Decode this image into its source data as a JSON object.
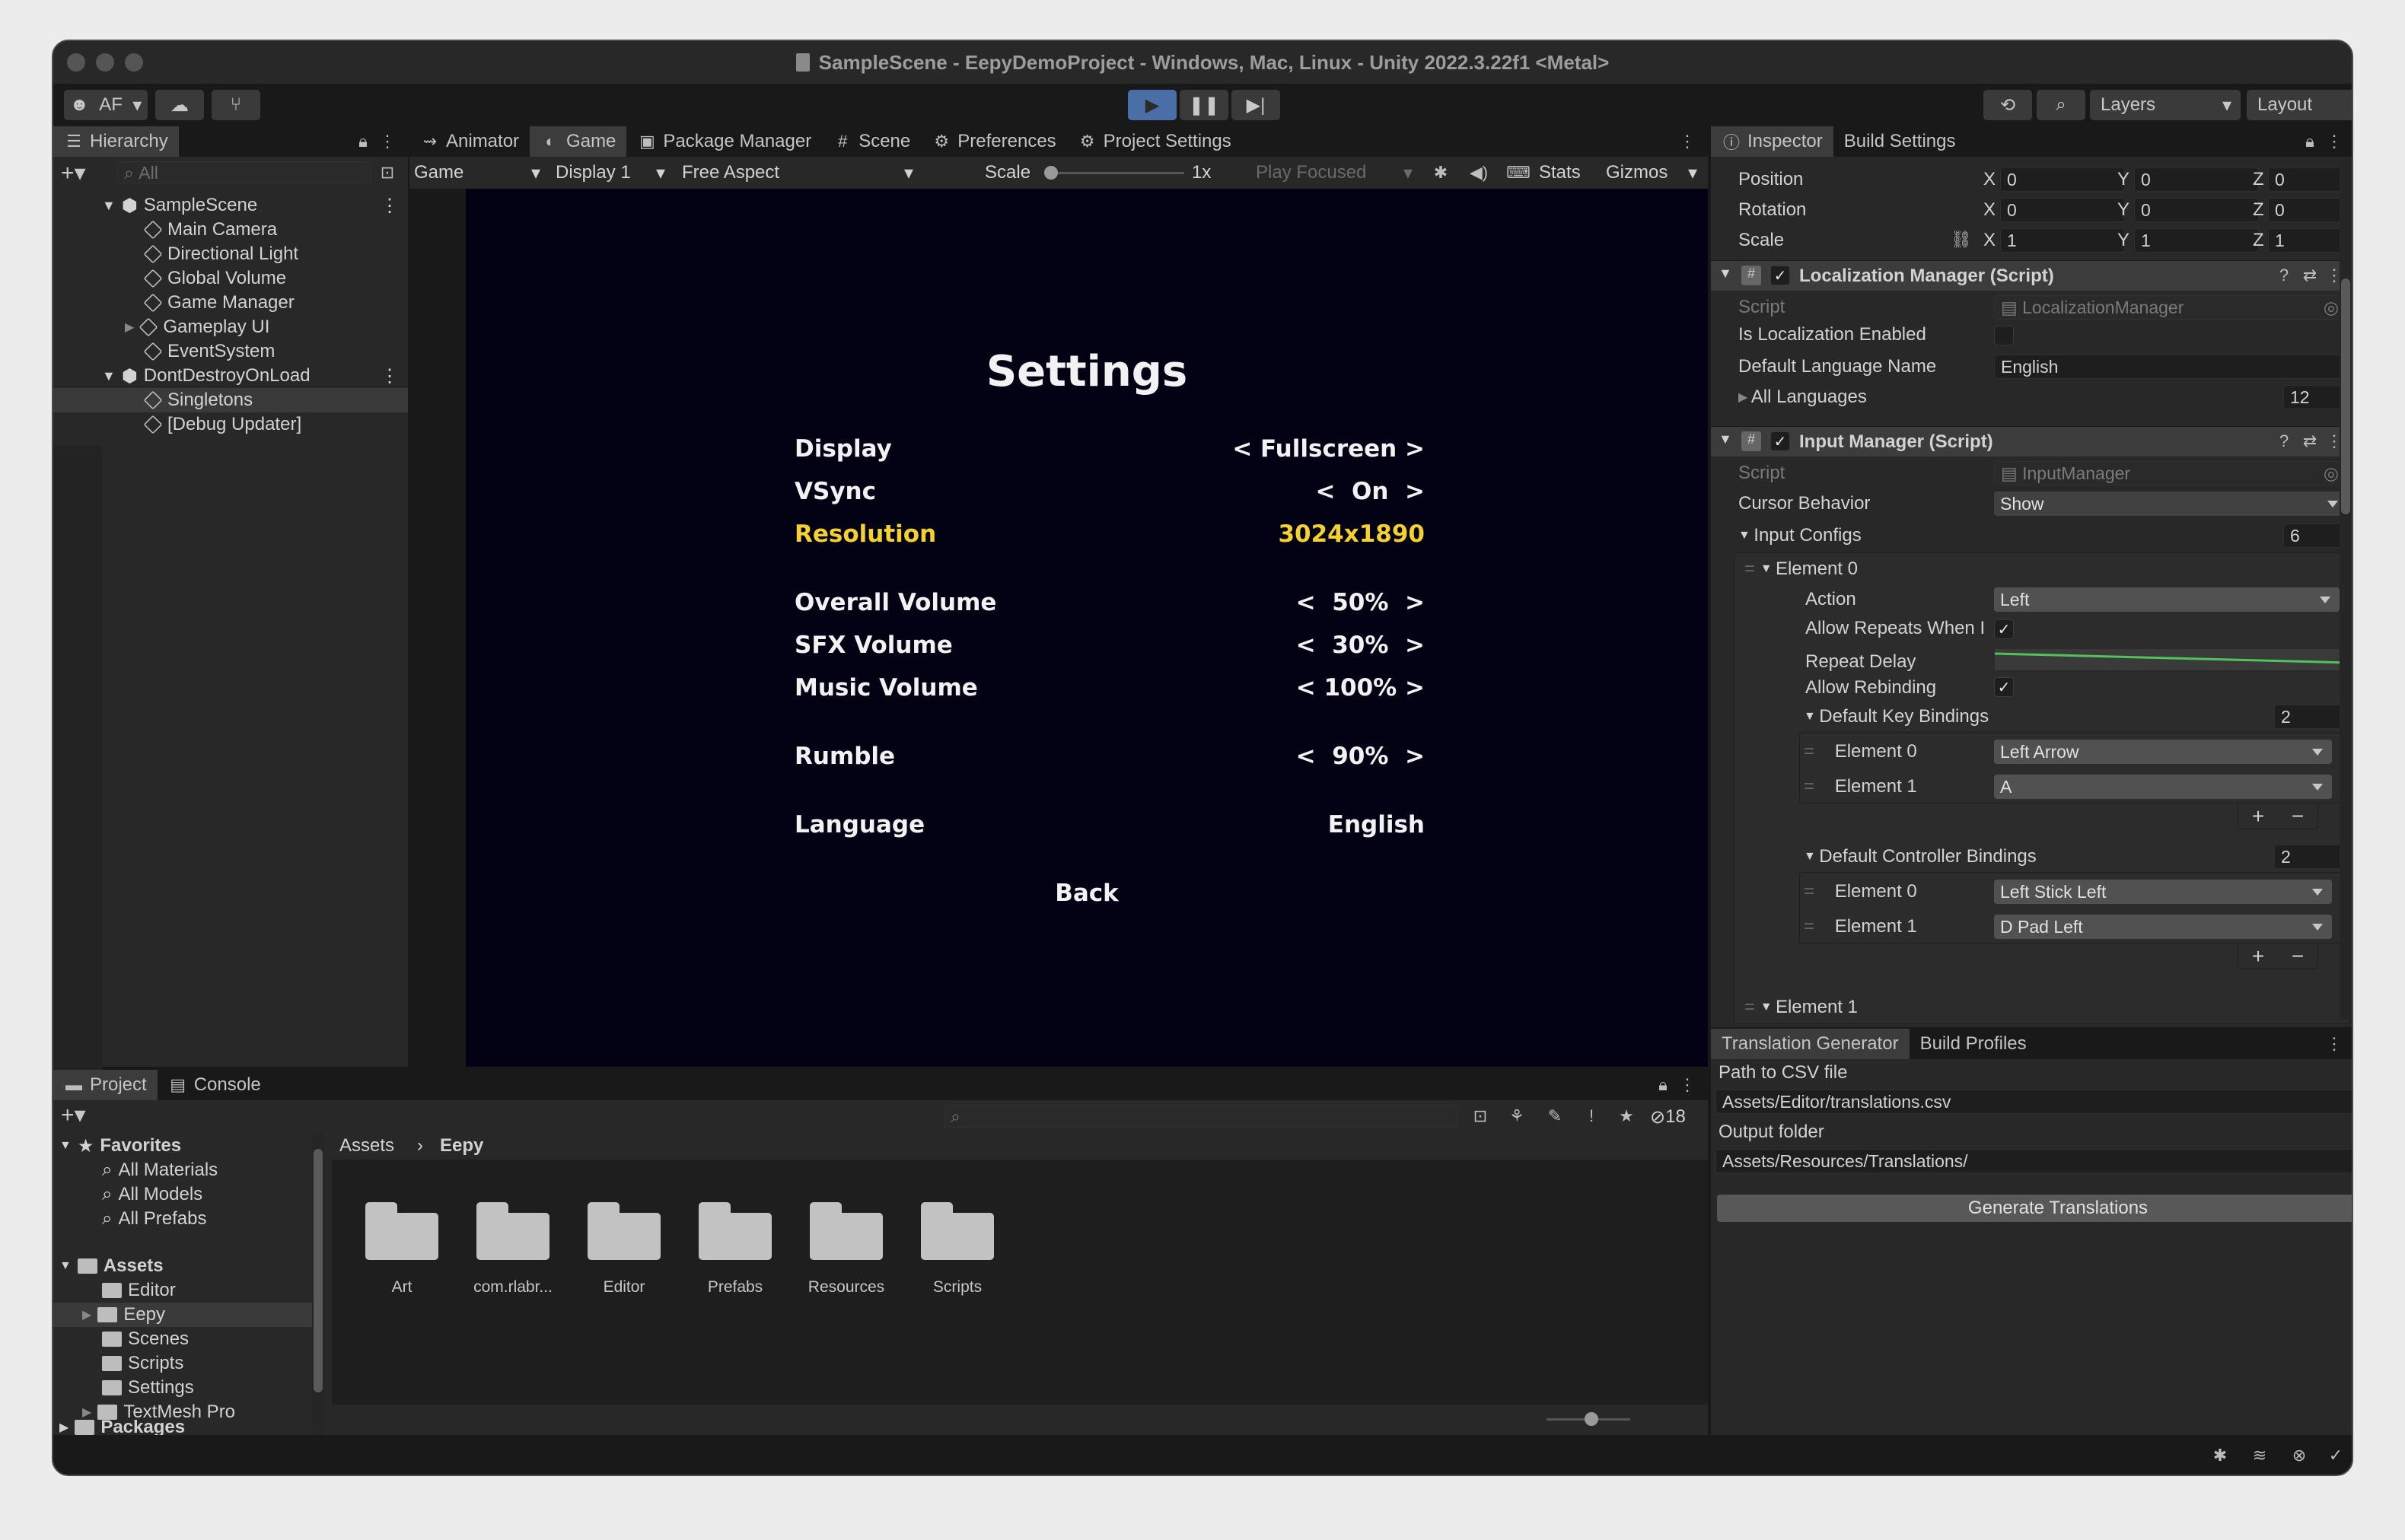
{
  "window": {
    "title": "SampleScene - EepyDemoProject - Windows, Mac, Linux - Unity 2022.3.22f1 <Metal>"
  },
  "toolbar": {
    "account": "AF",
    "layers": "Layers",
    "layout": "Layout"
  },
  "hierarchy": {
    "tab": "Hierarchy",
    "search_placeholder": "All",
    "scene1": "SampleScene",
    "items1": [
      "Main Camera",
      "Directional Light",
      "Global Volume",
      "Game Manager",
      "Gameplay UI",
      "EventSystem"
    ],
    "scene2": "DontDestroyOnLoad",
    "items2": [
      "Singletons",
      "[Debug Updater]"
    ]
  },
  "center_tabs": [
    "Animator",
    "Game",
    "Package Manager",
    "Scene",
    "Preferences",
    "Project Settings"
  ],
  "game_toolbar": {
    "mode": "Game",
    "display": "Display 1",
    "aspect": "Free Aspect",
    "scale_label": "Scale",
    "scale_value": "1x",
    "play_mode": "Play Focused",
    "stats": "Stats",
    "gizmos": "Gizmos"
  },
  "game": {
    "title": "Settings",
    "rows": [
      {
        "label": "Display",
        "value": "< Fullscreen >"
      },
      {
        "label": "VSync",
        "value": "<  On  >"
      },
      {
        "label": "Resolution",
        "value": "3024x1890"
      },
      {
        "label": "Overall Volume",
        "value": "<  50%  >"
      },
      {
        "label": "SFX Volume",
        "value": "<  30%  >"
      },
      {
        "label": "Music Volume",
        "value": "< 100% >"
      },
      {
        "label": "Rumble",
        "value": "<  90%  >"
      },
      {
        "label": "Language",
        "value": "English"
      }
    ],
    "back": "Back",
    "highlight_color": "#f5d130"
  },
  "inspector": {
    "tabs": [
      "Inspector",
      "Build Settings"
    ],
    "transform": {
      "position": {
        "label": "Position",
        "x": "0",
        "y": "0",
        "z": "0"
      },
      "rotation": {
        "label": "Rotation",
        "x": "0",
        "y": "0",
        "z": "0"
      },
      "scale": {
        "label": "Scale",
        "x": "1",
        "y": "1",
        "z": "1"
      }
    },
    "loc": {
      "header": "Localization Manager (Script)",
      "script_label": "Script",
      "script_value": "LocalizationManager",
      "enabled_label": "Is Localization Enabled",
      "lang_label": "Default Language Name",
      "lang_value": "English",
      "all_label": "All Languages",
      "all_value": "12"
    },
    "input": {
      "header": "Input Manager (Script)",
      "script_label": "Script",
      "script_value": "InputManager",
      "cursor_label": "Cursor Behavior",
      "cursor_value": "Show",
      "configs_label": "Input Configs",
      "configs_value": "6",
      "element0": "Element 0",
      "action_label": "Action",
      "action_value": "Left",
      "repeat_label": "Allow Repeats When I",
      "delay_label": "Repeat Delay",
      "rebind_label": "Allow Rebinding",
      "keys_label": "Default Key Bindings",
      "keys_count": "2",
      "keys": [
        {
          "label": "Element 0",
          "value": "Left Arrow"
        },
        {
          "label": "Element 1",
          "value": "A"
        }
      ],
      "ctrl_label": "Default Controller Bindings",
      "ctrl_count": "2",
      "ctrl": [
        {
          "label": "Element 0",
          "value": "Left Stick Left"
        },
        {
          "label": "Element 1",
          "value": "D Pad Left"
        }
      ],
      "element1": "Element 1"
    }
  },
  "translation": {
    "tabs": [
      "Translation Generator",
      "Build Profiles"
    ],
    "csv_label": "Path to CSV file",
    "csv_value": "Assets/Editor/translations.csv",
    "out_label": "Output folder",
    "out_value": "Assets/Resources/Translations/",
    "button": "Generate Translations"
  },
  "project": {
    "tabs": [
      "Project",
      "Console"
    ],
    "hidden_count": "18",
    "favorites": "Favorites",
    "fav_items": [
      "All Materials",
      "All Models",
      "All Prefabs"
    ],
    "assets": "Assets",
    "asset_items": [
      "Editor",
      "Eepy",
      "Scenes",
      "Scripts",
      "Settings",
      "TextMesh Pro"
    ],
    "packages": "Packages",
    "breadcrumb": [
      "Assets",
      "Eepy"
    ],
    "folders": [
      "Art",
      "com.rlabr...",
      "Editor",
      "Prefabs",
      "Resources",
      "Scripts"
    ]
  }
}
